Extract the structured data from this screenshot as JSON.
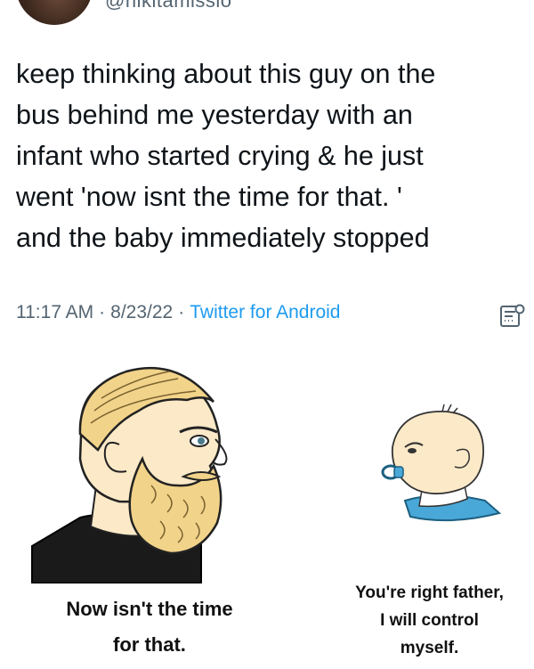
{
  "author": {
    "handle": "@nikitamissio"
  },
  "tweet": {
    "lines": [
      "keep thinking about this guy on the",
      "bus behind me yesterday with an",
      "infant who started crying & he just",
      "went 'now isnt the time for that. '",
      "and the baby immediately stopped"
    ],
    "time": "11:17 AM",
    "date": "8/23/22",
    "source": "Twitter for Android",
    "separator": "·"
  },
  "meme": {
    "left_caption_lines": [
      "Now isn't the time",
      "for that."
    ],
    "right_caption_lines": [
      "You're right father,",
      "I will control",
      "myself."
    ],
    "colors": {
      "skin": "#fbe9c8",
      "hair": "#f2d38a",
      "shirt": "#1a1a1a",
      "baby_shirt": "#4aa8d8"
    }
  },
  "icons": {
    "analytics": "analytics-icon"
  }
}
